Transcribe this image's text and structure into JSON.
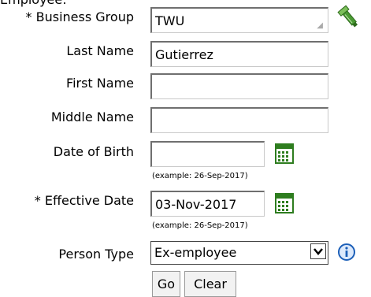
{
  "header": {
    "partial_title": "Employee:"
  },
  "form": {
    "business_group": {
      "label": "Business Group",
      "required_mark": "*",
      "value": "TWU"
    },
    "last_name": {
      "label": "Last Name",
      "value": "Gutierrez"
    },
    "first_name": {
      "label": "First Name",
      "value": ""
    },
    "middle_name": {
      "label": "Middle Name",
      "value": ""
    },
    "date_of_birth": {
      "label": "Date of Birth",
      "value": "",
      "hint": "(example: 26-Sep-2017)"
    },
    "effective_date": {
      "label": "Effective Date",
      "required_mark": "*",
      "value": "03-Nov-2017",
      "hint": "(example: 26-Sep-2017)"
    },
    "person_type": {
      "label": "Person Type",
      "value": "Ex-employee"
    }
  },
  "buttons": {
    "go": "Go",
    "clear": "Clear"
  },
  "icons": {
    "lov": "flashlight-search-icon",
    "calendar": "calendar-icon",
    "info": "info-icon",
    "dropdown": "chevron-down-icon"
  },
  "colors": {
    "calendar_green": "#2e7d1f",
    "info_blue": "#1c5fb8",
    "border_dark": "#6f6f6f"
  }
}
